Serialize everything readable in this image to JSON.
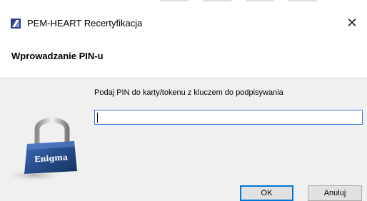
{
  "window": {
    "title": "PEM-HEART Recertyfikacja",
    "close_glyph": "✕"
  },
  "header": {
    "title": "Wprowadzanie PIN-u"
  },
  "form": {
    "prompt": "Podaj PIN do karty/tokenu z kluczem do podpisywania",
    "pin_value": "",
    "pin_placeholder": ""
  },
  "lock": {
    "label": "Enigma",
    "icon": "padlock-icon"
  },
  "buttons": {
    "ok_label": "OK",
    "cancel_label": "Anuluj"
  },
  "colors": {
    "accent": "#0078d7",
    "lock_body": "#1e3f78"
  }
}
